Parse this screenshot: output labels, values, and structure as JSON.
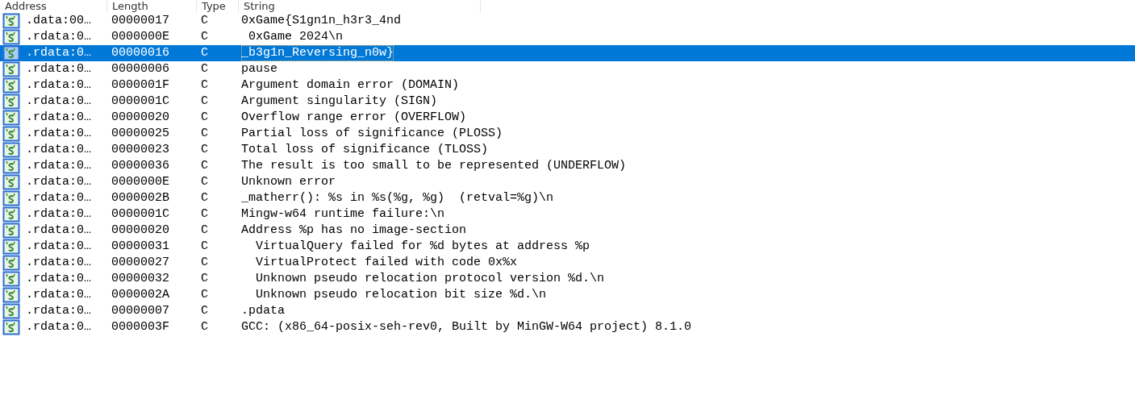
{
  "table": {
    "columns": [
      {
        "label": "Address"
      },
      {
        "label": "Length"
      },
      {
        "label": "Type"
      },
      {
        "label": "String"
      }
    ],
    "rows": [
      {
        "address": ".data:00…",
        "length": "00000017",
        "type": "C",
        "string": "0xGame{S1gn1n_h3r3_4nd",
        "selected": false
      },
      {
        "address": ".rdata:0…",
        "length": "0000000E",
        "type": "C",
        "string": " 0xGame 2024\\n",
        "selected": false
      },
      {
        "address": ".rdata:0…",
        "length": "00000016",
        "type": "C",
        "string": "_b3g1n_Reversing_n0w}",
        "selected": true
      },
      {
        "address": ".rdata:0…",
        "length": "00000006",
        "type": "C",
        "string": "pause",
        "selected": false
      },
      {
        "address": ".rdata:0…",
        "length": "0000001F",
        "type": "C",
        "string": "Argument domain error (DOMAIN)",
        "selected": false
      },
      {
        "address": ".rdata:0…",
        "length": "0000001C",
        "type": "C",
        "string": "Argument singularity (SIGN)",
        "selected": false
      },
      {
        "address": ".rdata:0…",
        "length": "00000020",
        "type": "C",
        "string": "Overflow range error (OVERFLOW)",
        "selected": false
      },
      {
        "address": ".rdata:0…",
        "length": "00000025",
        "type": "C",
        "string": "Partial loss of significance (PLOSS)",
        "selected": false
      },
      {
        "address": ".rdata:0…",
        "length": "00000023",
        "type": "C",
        "string": "Total loss of significance (TLOSS)",
        "selected": false
      },
      {
        "address": ".rdata:0…",
        "length": "00000036",
        "type": "C",
        "string": "The result is too small to be represented (UNDERFLOW)",
        "selected": false
      },
      {
        "address": ".rdata:0…",
        "length": "0000000E",
        "type": "C",
        "string": "Unknown error",
        "selected": false
      },
      {
        "address": ".rdata:0…",
        "length": "0000002B",
        "type": "C",
        "string": "_matherr(): %s in %s(%g, %g)  (retval=%g)\\n",
        "selected": false
      },
      {
        "address": ".rdata:0…",
        "length": "0000001C",
        "type": "C",
        "string": "Mingw-w64 runtime failure:\\n",
        "selected": false
      },
      {
        "address": ".rdata:0…",
        "length": "00000020",
        "type": "C",
        "string": "Address %p has no image-section",
        "selected": false
      },
      {
        "address": ".rdata:0…",
        "length": "00000031",
        "type": "C",
        "string": "  VirtualQuery failed for %d bytes at address %p",
        "selected": false
      },
      {
        "address": ".rdata:0…",
        "length": "00000027",
        "type": "C",
        "string": "  VirtualProtect failed with code 0x%x",
        "selected": false
      },
      {
        "address": ".rdata:0…",
        "length": "00000032",
        "type": "C",
        "string": "  Unknown pseudo relocation protocol version %d.\\n",
        "selected": false
      },
      {
        "address": ".rdata:0…",
        "length": "0000002A",
        "type": "C",
        "string": "  Unknown pseudo relocation bit size %d.\\n",
        "selected": false
      },
      {
        "address": ".rdata:0…",
        "length": "00000007",
        "type": "C",
        "string": ".pdata",
        "selected": false
      },
      {
        "address": ".rdata:0…",
        "length": "0000003F",
        "type": "C",
        "string": "GCC: (x86_64-posix-seh-rev0, Built by MinGW-W64 project) 8.1.0",
        "selected": false
      }
    ]
  }
}
